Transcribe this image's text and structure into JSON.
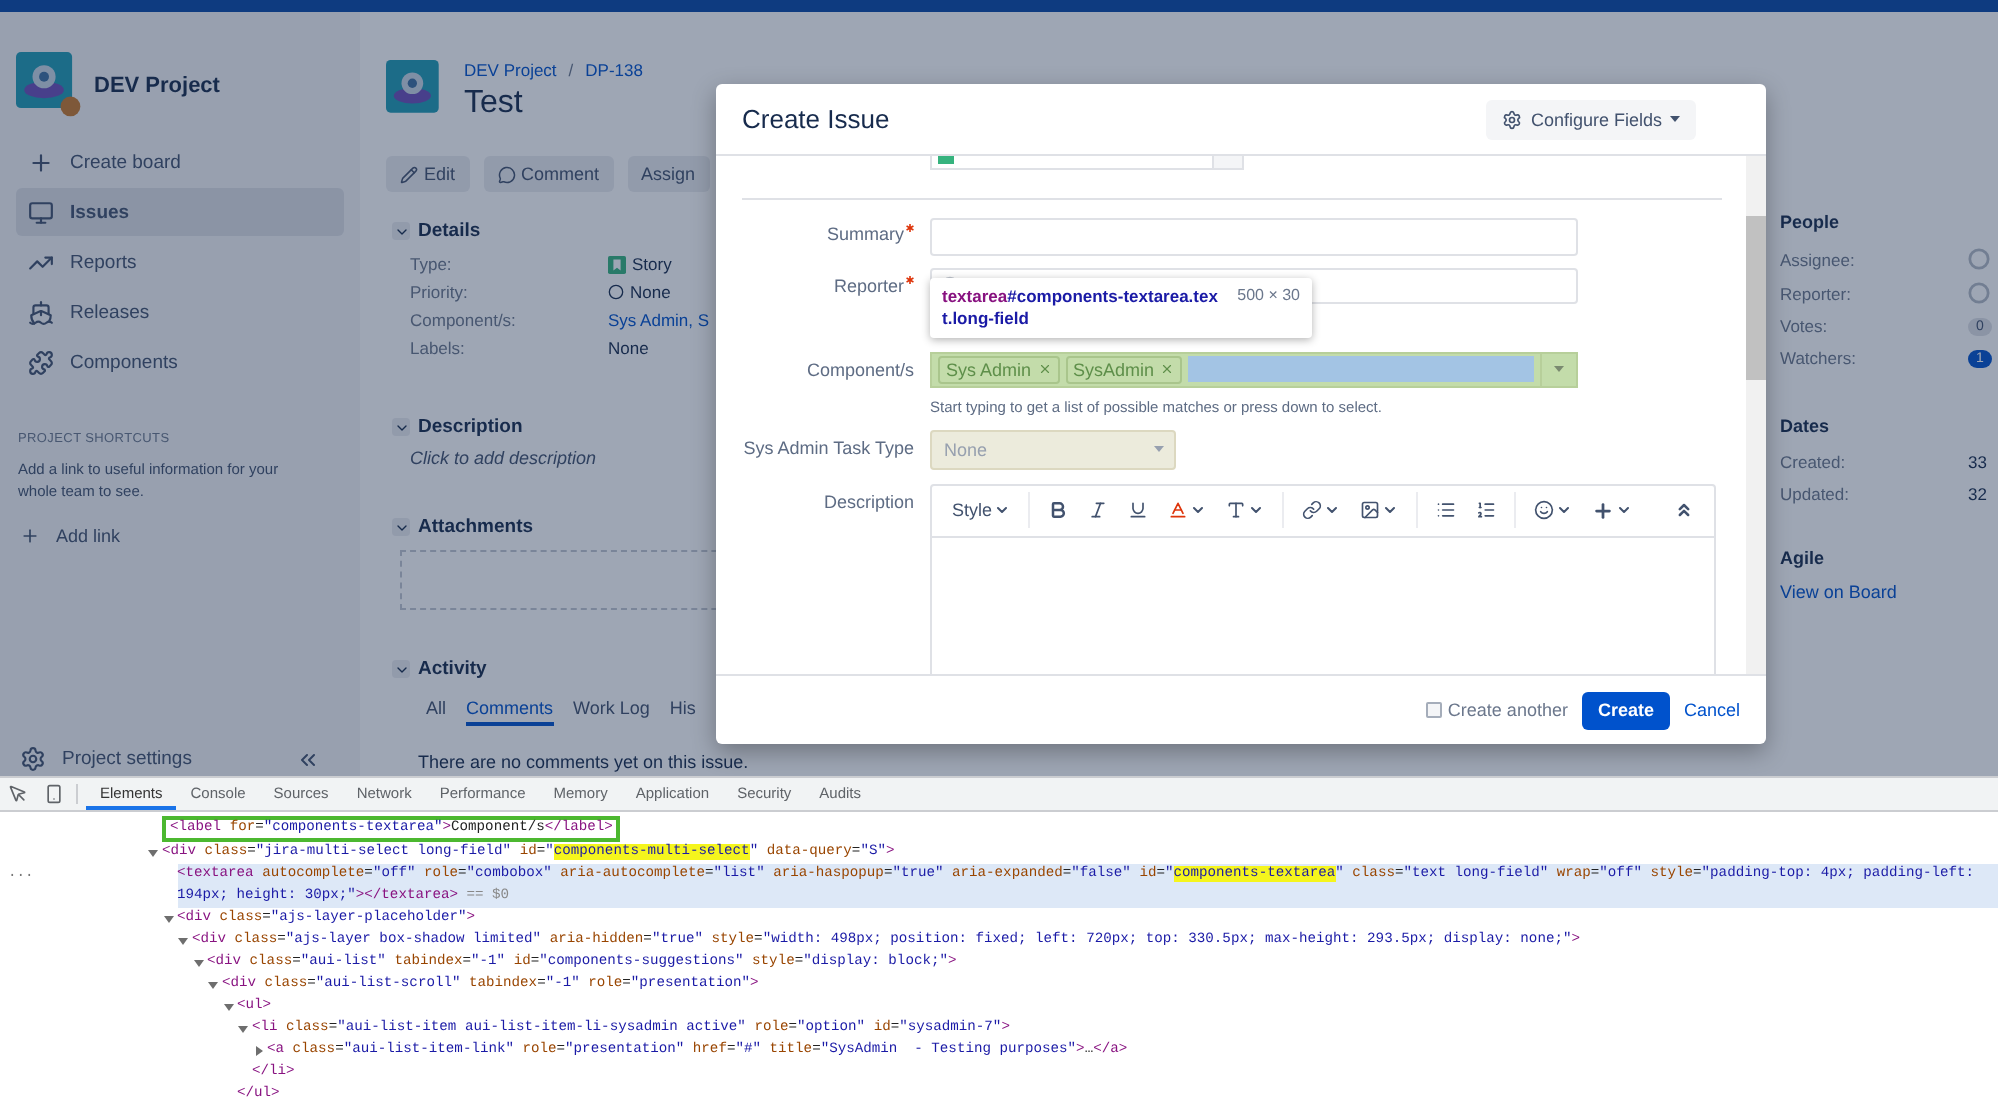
{
  "sidebar": {
    "project": "DEV Project",
    "create_board": "Create board",
    "nav": [
      {
        "label": "Issues",
        "selected": true
      },
      {
        "label": "Reports",
        "selected": false
      },
      {
        "label": "Releases",
        "selected": false
      },
      {
        "label": "Components",
        "selected": false
      }
    ],
    "shortcuts_heading": "PROJECT SHORTCUTS",
    "shortcuts_text": "Add a link to useful information for your whole team to see.",
    "add_link": "Add link",
    "settings": "Project settings"
  },
  "issue": {
    "breadcrumb": [
      "DEV Project",
      "DP-138"
    ],
    "breadcrumb_separator": "/",
    "title": "Test",
    "actions": [
      "Edit",
      "Comment",
      "Assign"
    ],
    "details": {
      "heading": "Details",
      "expanded": true,
      "fields": [
        {
          "label": "Type:",
          "value": "Story",
          "kind": "type"
        },
        {
          "label": "Priority:",
          "value": "None",
          "kind": "priority"
        },
        {
          "label": "Component/s:",
          "value": "Sys Admin, S",
          "kind": "link"
        },
        {
          "label": "Labels:",
          "value": "None",
          "kind": "text"
        }
      ]
    },
    "description": {
      "heading": "Description",
      "expanded": true,
      "placeholder": "Click to add description"
    },
    "attachments": {
      "heading": "Attachments",
      "expanded": true
    },
    "activity": {
      "heading": "Activity",
      "expanded": true,
      "tabs": [
        {
          "label": "All",
          "selected": false
        },
        {
          "label": "Comments",
          "selected": true
        },
        {
          "label": "Work Log",
          "selected": false
        },
        {
          "label": "His",
          "selected": false
        }
      ],
      "empty": "There are no comments yet on this issue."
    }
  },
  "people": {
    "heading": "People",
    "fields": [
      {
        "label": "Assignee:",
        "kind": "avatar"
      },
      {
        "label": "Reporter:",
        "kind": "avatar"
      },
      {
        "label": "Votes:",
        "kind": "count",
        "value": "0"
      },
      {
        "label": "Watchers:",
        "kind": "count_active",
        "value": "1"
      }
    ]
  },
  "dates": {
    "heading": "Dates",
    "fields": [
      {
        "label": "Created:",
        "value": "33"
      },
      {
        "label": "Updated:",
        "value": "32"
      }
    ]
  },
  "agile": {
    "heading": "Agile",
    "link": "View on Board"
  },
  "dialog": {
    "title": "Create Issue",
    "configure": "Configure Fields",
    "fields": [
      {
        "kind": "text",
        "label": "Summary",
        "required": true
      },
      {
        "kind": "user",
        "label": "Reporter",
        "required": true
      },
      {
        "kind": "multi",
        "label": "Component/s",
        "required": false,
        "tokens": [
          "Sys Admin",
          "SysAdmin"
        ],
        "help": "Start typing to get a list of possible matches or press down to select."
      },
      {
        "kind": "select",
        "label": "Sys Admin Task Type",
        "required": false,
        "value": "None",
        "disabled": true
      },
      {
        "kind": "editor",
        "label": "Description",
        "required": false,
        "style": "Style"
      }
    ],
    "inspect_tooltip": {
      "tag": "textarea",
      "selector": "#components-textarea.text.long-field",
      "size": "500 × 30"
    },
    "create_another": {
      "label": "Create another",
      "checked": false
    },
    "submit": "Create",
    "cancel": "Cancel"
  },
  "devtools": {
    "tabs": [
      {
        "label": "Elements",
        "selected": true
      },
      {
        "label": "Console",
        "selected": false
      },
      {
        "label": "Sources",
        "selected": false
      },
      {
        "label": "Network",
        "selected": false
      },
      {
        "label": "Performance",
        "selected": false
      },
      {
        "label": "Memory",
        "selected": false
      },
      {
        "label": "Application",
        "selected": false
      },
      {
        "label": "Security",
        "selected": false
      },
      {
        "label": "Audits",
        "selected": false
      }
    ],
    "tree": [
      {
        "parts": [
          "<label for=\"components-textarea\">Component/s</label>"
        ],
        "outlined": true,
        "selected": false
      },
      {
        "parts": [
          "<div class=\"jira-multi-select long-field\" id=\"",
          {
            "text": "components-multi-select",
            "highlight": true
          },
          "\" data-query=\"S\">"
        ],
        "expanded": true,
        "selected": false,
        "outlined": false,
        "children": [
          {
            "gutter": "...",
            "parts": [
              "<textarea autocomplete=\"off\" role=\"combobox\" aria-autocomplete=\"list\" aria-haspopup=\"true\" aria-expanded=\"false\" id=\"",
              {
                "text": "components-textarea",
                "highlight": true
              },
              "\" class=\"text long-field\" wrap=\"off\" style=\"padding-top: 4px; padding-left: 194px; height: 30px;\"></textarea>"
            ],
            "suffix": "== $0",
            "selected": true,
            "outlined": false
          },
          {
            "parts": [
              "<div class=\"ajs-layer-placeholder\">"
            ],
            "expanded": true,
            "selected": false,
            "outlined": false,
            "children": [
              {
                "parts": [
                  "<div class=\"ajs-layer box-shadow limited\" aria-hidden=\"true\" style=\"width: 498px; position: fixed; left: 720px; top: 330.5px; max-height: 293.5px; display: none;\">"
                ],
                "expanded": true,
                "selected": false,
                "outlined": false,
                "children": [
                  {
                    "parts": [
                      "<div class=\"aui-list\" tabindex=\"-1\" id=\"components-suggestions\" style=\"display: block;\">"
                    ],
                    "expanded": true,
                    "selected": false,
                    "outlined": false,
                    "children": [
                      {
                        "parts": [
                          "<div class=\"aui-list-scroll\" tabindex=\"-1\" role=\"presentation\">"
                        ],
                        "expanded": true,
                        "selected": false,
                        "outlined": false,
                        "children": [
                          {
                            "parts": [
                              "<ul>"
                            ],
                            "expanded": true,
                            "selected": false,
                            "outlined": false,
                            "close": "</ul>",
                            "children": [
                              {
                                "parts": [
                                  "<li class=\"aui-list-item aui-list-item-li-sysadmin active\" role=\"option\" id=\"sysadmin-7\">"
                                ],
                                "expanded": true,
                                "selected": false,
                                "outlined": false,
                                "close": "</li>",
                                "children": [
                                  {
                                    "parts": [
                                      "<a class=\"aui-list-item-link\" role=\"presentation\" href=\"#\" title=\"SysAdmin  - Testing purposes\">…</a>"
                                    ],
                                    "expanded": false,
                                    "selected": false,
                                    "outlined": false
                                  }
                                ]
                              }
                            ]
                          }
                        ]
                      }
                    ]
                  }
                ]
              }
            ]
          }
        ]
      }
    ]
  }
}
